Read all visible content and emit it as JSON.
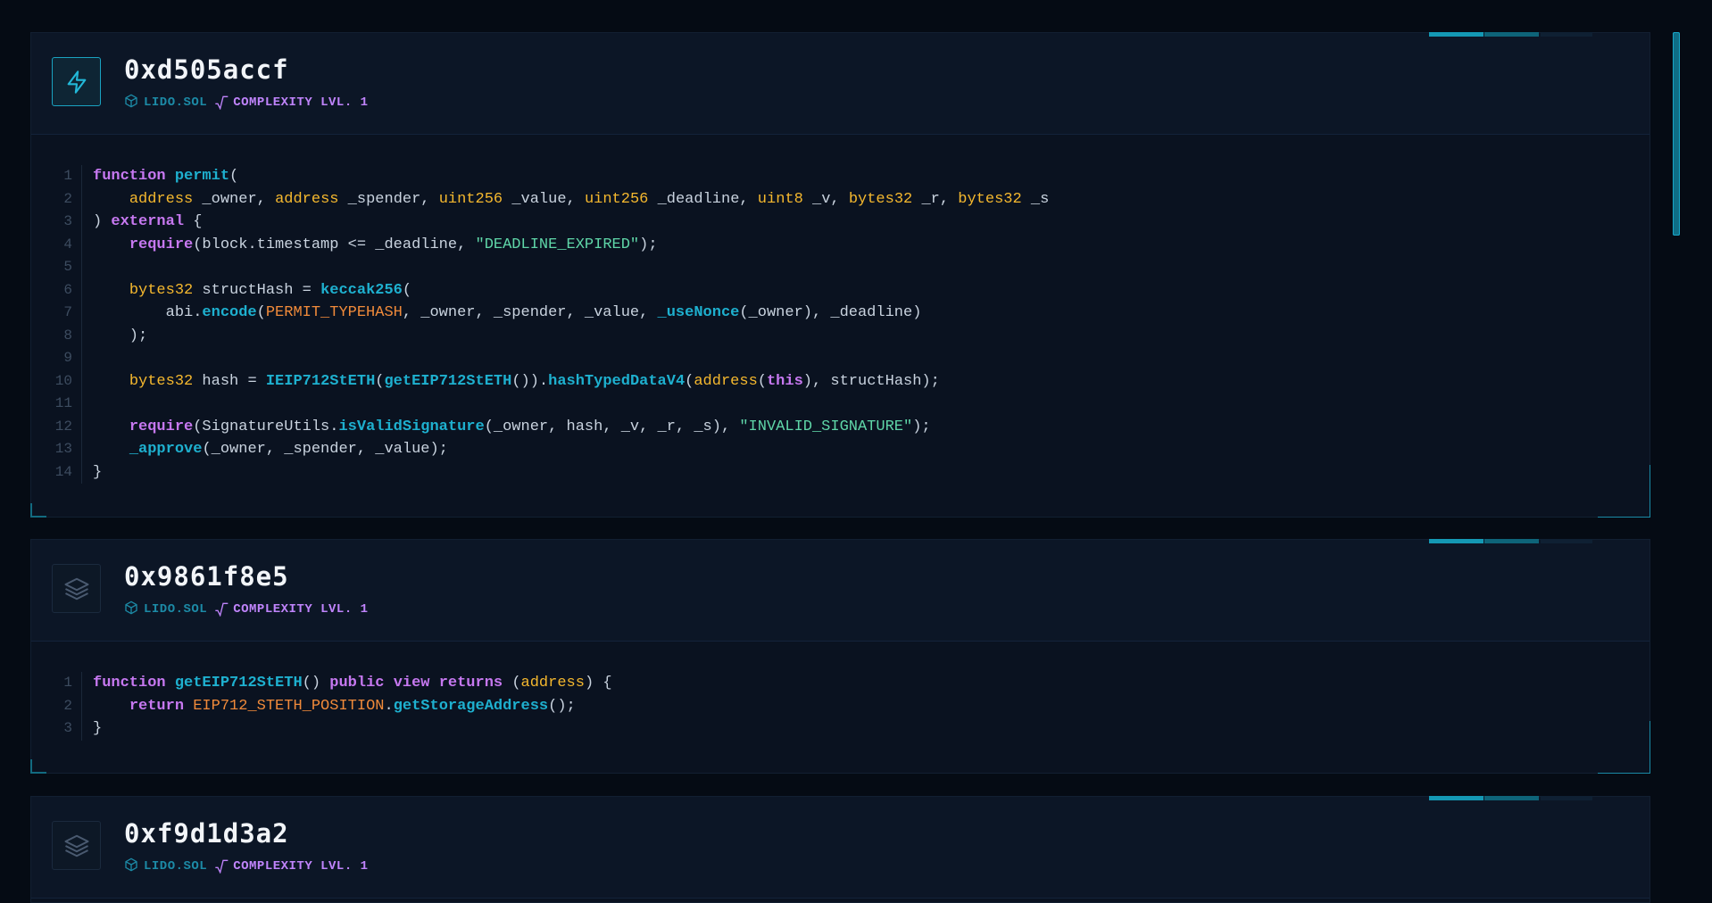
{
  "colors": {
    "background": "#050b14",
    "panel": "#0a1220",
    "accent": "#1498b4",
    "keyword": "#c678f0",
    "function": "#1eb0cf",
    "type": "#f5b82e",
    "string": "#5fd6a8",
    "constant": "#f08a3a"
  },
  "panels": [
    {
      "hash": "0xd505accf",
      "file": "LIDO.SOL",
      "complexity": "COMPLEXITY LVL. 1",
      "icon": "lightning-icon",
      "active": true,
      "lines": [
        [
          [
            "kw",
            "function"
          ],
          [
            "p",
            " "
          ],
          [
            "fn",
            "permit"
          ],
          [
            "p",
            "("
          ]
        ],
        [
          [
            "p",
            "    "
          ],
          [
            "ty",
            "address"
          ],
          [
            "p",
            " _owner, "
          ],
          [
            "ty",
            "address"
          ],
          [
            "p",
            " _spender, "
          ],
          [
            "ty",
            "uint256"
          ],
          [
            "p",
            " _value, "
          ],
          [
            "ty",
            "uint256"
          ],
          [
            "p",
            " _deadline, "
          ],
          [
            "ty",
            "uint8"
          ],
          [
            "p",
            " _v, "
          ],
          [
            "ty",
            "bytes32"
          ],
          [
            "p",
            " _r, "
          ],
          [
            "ty",
            "bytes32"
          ],
          [
            "p",
            " _s"
          ]
        ],
        [
          [
            "p",
            ") "
          ],
          [
            "kw",
            "external"
          ],
          [
            "p",
            " {"
          ]
        ],
        [
          [
            "p",
            "    "
          ],
          [
            "kw",
            "require"
          ],
          [
            "p",
            "(block.timestamp <= _deadline, "
          ],
          [
            "st",
            "\"DEADLINE_EXPIRED\""
          ],
          [
            "p",
            ");"
          ]
        ],
        [
          [
            "p",
            ""
          ]
        ],
        [
          [
            "p",
            "    "
          ],
          [
            "ty",
            "bytes32"
          ],
          [
            "p",
            " structHash = "
          ],
          [
            "fn",
            "keccak256"
          ],
          [
            "p",
            "("
          ]
        ],
        [
          [
            "p",
            "        abi."
          ],
          [
            "fn",
            "encode"
          ],
          [
            "p",
            "("
          ],
          [
            "cn",
            "PERMIT_TYPEHASH"
          ],
          [
            "p",
            ", _owner, _spender, _value, "
          ],
          [
            "fn",
            "_useNonce"
          ],
          [
            "p",
            "(_owner), _deadline)"
          ]
        ],
        [
          [
            "p",
            "    );"
          ]
        ],
        [
          [
            "p",
            ""
          ]
        ],
        [
          [
            "p",
            "    "
          ],
          [
            "ty",
            "bytes32"
          ],
          [
            "p",
            " hash = "
          ],
          [
            "fn",
            "IEIP712StETH"
          ],
          [
            "p",
            "("
          ],
          [
            "fn",
            "getEIP712StETH"
          ],
          [
            "p",
            "())."
          ],
          [
            "fn",
            "hashTypedDataV4"
          ],
          [
            "p",
            "("
          ],
          [
            "ty",
            "address"
          ],
          [
            "p",
            "("
          ],
          [
            "kw",
            "this"
          ],
          [
            "p",
            "), structHash);"
          ]
        ],
        [
          [
            "p",
            ""
          ]
        ],
        [
          [
            "p",
            "    "
          ],
          [
            "kw",
            "require"
          ],
          [
            "p",
            "(SignatureUtils."
          ],
          [
            "fn",
            "isValidSignature"
          ],
          [
            "p",
            "(_owner, hash, _v, _r, _s), "
          ],
          [
            "st",
            "\"INVALID_SIGNATURE\""
          ],
          [
            "p",
            ");"
          ]
        ],
        [
          [
            "p",
            "    "
          ],
          [
            "fn",
            "_approve"
          ],
          [
            "p",
            "(_owner, _spender, _value);"
          ]
        ],
        [
          [
            "p",
            "}"
          ]
        ]
      ]
    },
    {
      "hash": "0x9861f8e5",
      "file": "LIDO.SOL",
      "complexity": "COMPLEXITY LVL. 1",
      "icon": "layers-icon",
      "active": false,
      "lines": [
        [
          [
            "kw",
            "function"
          ],
          [
            "p",
            " "
          ],
          [
            "fn",
            "getEIP712StETH"
          ],
          [
            "p",
            "() "
          ],
          [
            "kw",
            "public"
          ],
          [
            "p",
            " "
          ],
          [
            "kw",
            "view"
          ],
          [
            "p",
            " "
          ],
          [
            "kw",
            "returns"
          ],
          [
            "p",
            " ("
          ],
          [
            "ty",
            "address"
          ],
          [
            "p",
            ") {"
          ]
        ],
        [
          [
            "p",
            "    "
          ],
          [
            "kw",
            "return"
          ],
          [
            "p",
            " "
          ],
          [
            "cn",
            "EIP712_STETH_POSITION"
          ],
          [
            "p",
            "."
          ],
          [
            "fn",
            "getStorageAddress"
          ],
          [
            "p",
            "();"
          ]
        ],
        [
          [
            "p",
            "}"
          ]
        ]
      ]
    },
    {
      "hash": "0xf9d1d3a2",
      "file": "LIDO.SOL",
      "complexity": "COMPLEXITY LVL. 1",
      "icon": "layers-icon",
      "active": false,
      "lines": []
    }
  ]
}
